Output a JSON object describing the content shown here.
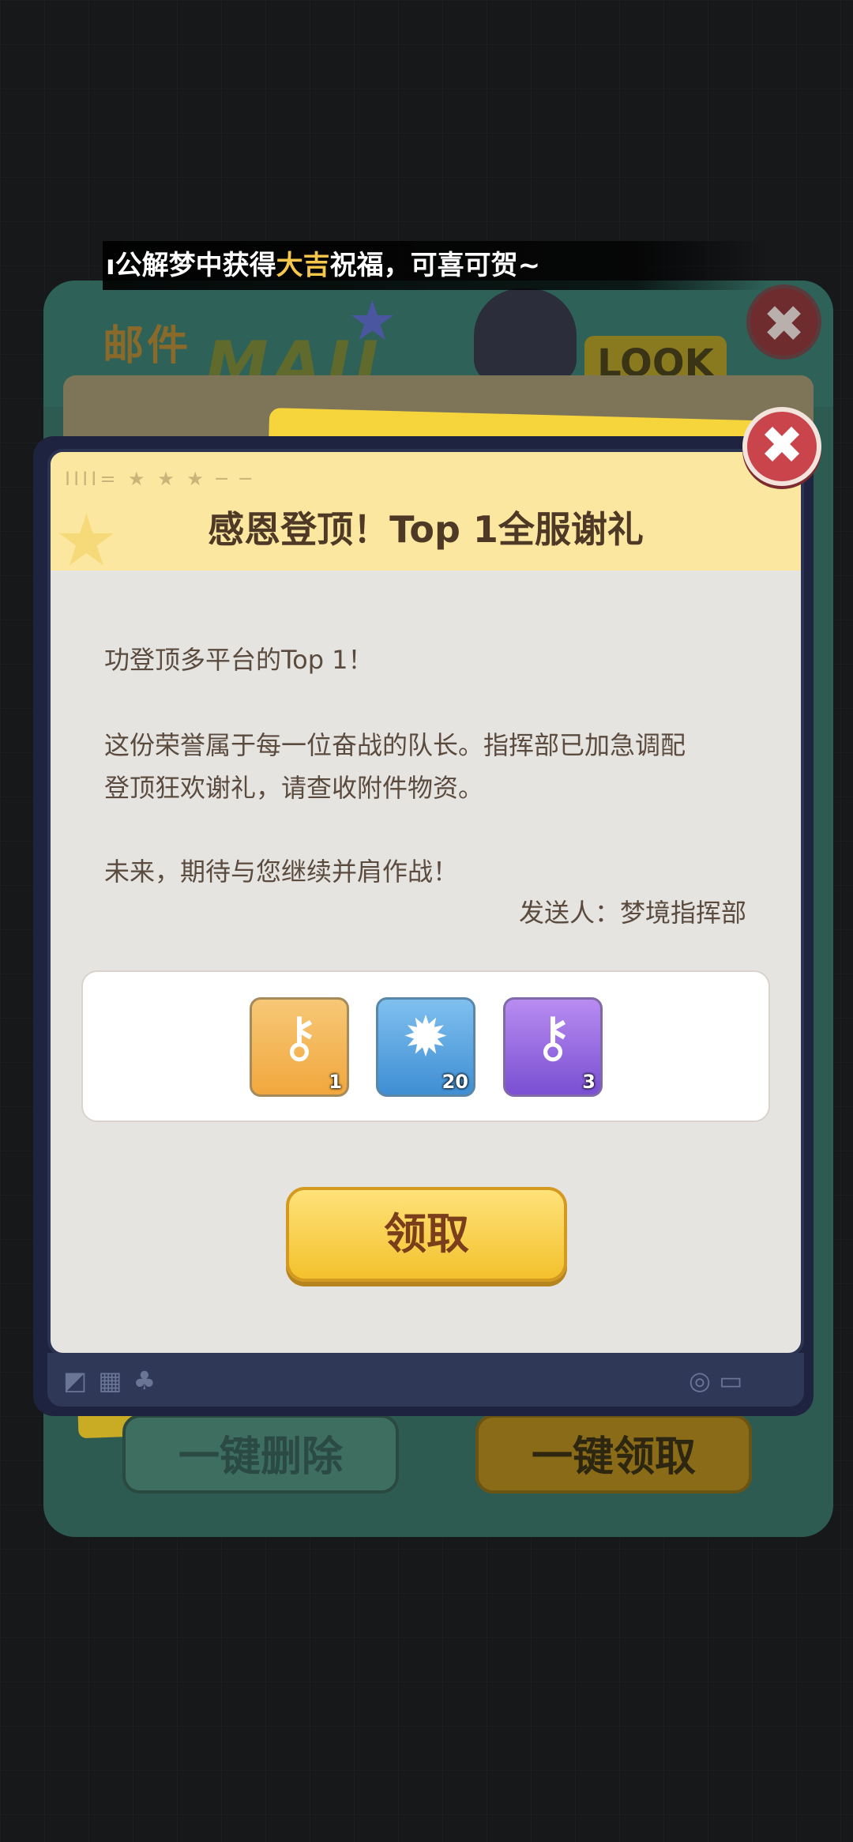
{
  "marquee": {
    "prefix": "ı公解梦中获得",
    "highlight": "大吉",
    "suffix": "祝福，可喜可贺~"
  },
  "background_panel": {
    "title": "邮件",
    "word": "MAIL",
    "look_badge": "LOOK",
    "delete_all_label": "一键删除",
    "claim_all_label": "一键领取"
  },
  "dialog": {
    "title": "感恩登顶！Top 1全服谢礼",
    "paragraphs": [
      "功登顶多平台的Top 1！",
      "这份荣誉属于每一位奋战的队长。指挥部已加急调配",
      "登顶狂欢谢礼，请查收附件物资。",
      "未来，期待与您继续并肩作战！"
    ],
    "sender": "发送人：梦境指挥部",
    "rewards": [
      {
        "icon": "star-key-icon",
        "count": "1",
        "color": "#f1a73d"
      },
      {
        "icon": "blue-crystal-icon",
        "count": "20",
        "color": "#3f8ed3"
      },
      {
        "icon": "purple-key-icon",
        "count": "3",
        "color": "#7a4fd2"
      }
    ],
    "claim_label": "领取",
    "close_glyph": "✖"
  },
  "colors": {
    "accent_yellow": "#f3c12c",
    "close_red": "#c9454b",
    "header_yellow": "#fbe7a0"
  }
}
